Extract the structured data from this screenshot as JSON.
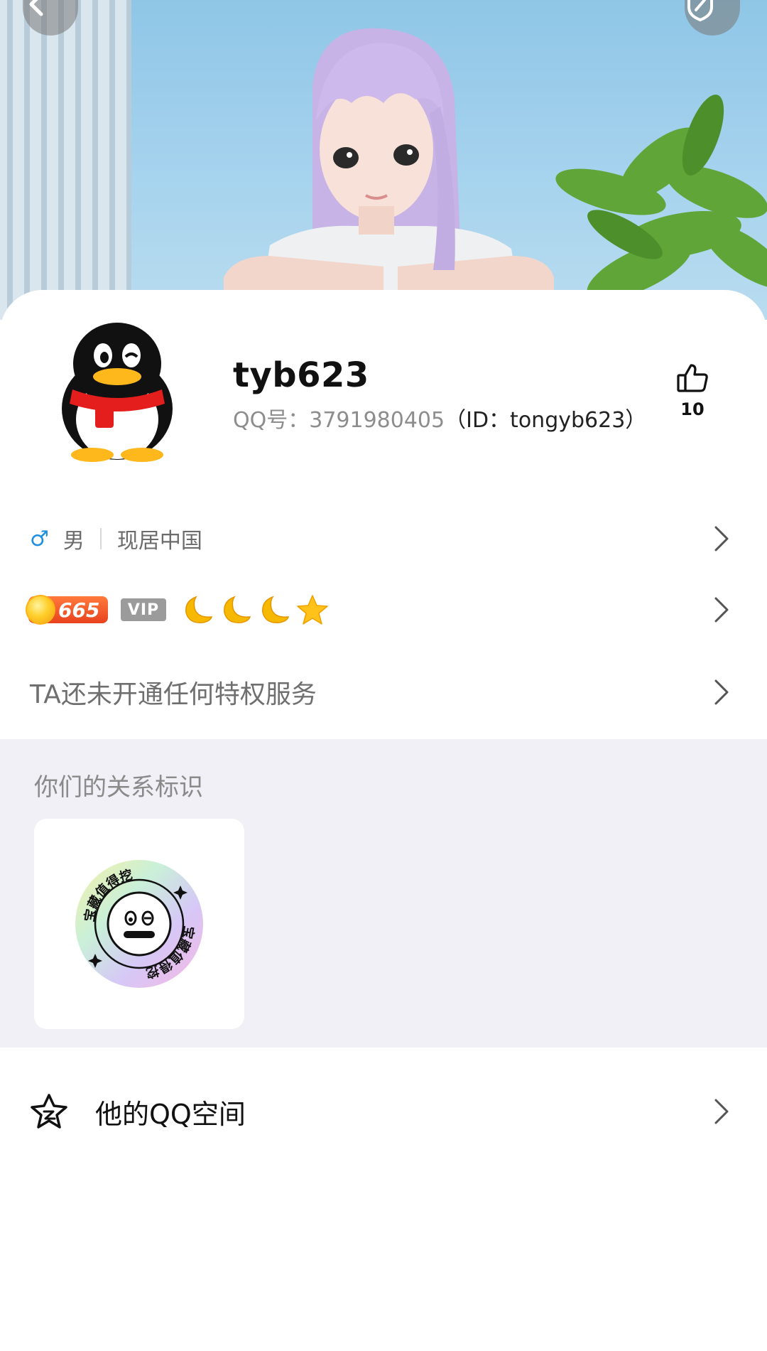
{
  "header": {
    "back_icon": "chevron-left-icon",
    "right_icon": "shield-icon"
  },
  "profile": {
    "nickname": "tyb623",
    "qq_label": "QQ号：3791980405",
    "id_label": "（ID：tongyb623）",
    "likes": "10"
  },
  "info": {
    "gender_symbol": "♂",
    "gender": "男",
    "location": "现居中国",
    "level_number": "665",
    "vip_label": "VIP",
    "privilege_text": "TA还未开通任何特权服务"
  },
  "relation": {
    "title": "你们的关系标识",
    "badge_text": "宝藏值得挖掘"
  },
  "qzone": {
    "label": "他的QQ空间"
  },
  "colors": {
    "accent_blue": "#1f8fe0",
    "section_bg": "#f0f0f6",
    "level_badge": "#e9421d"
  }
}
